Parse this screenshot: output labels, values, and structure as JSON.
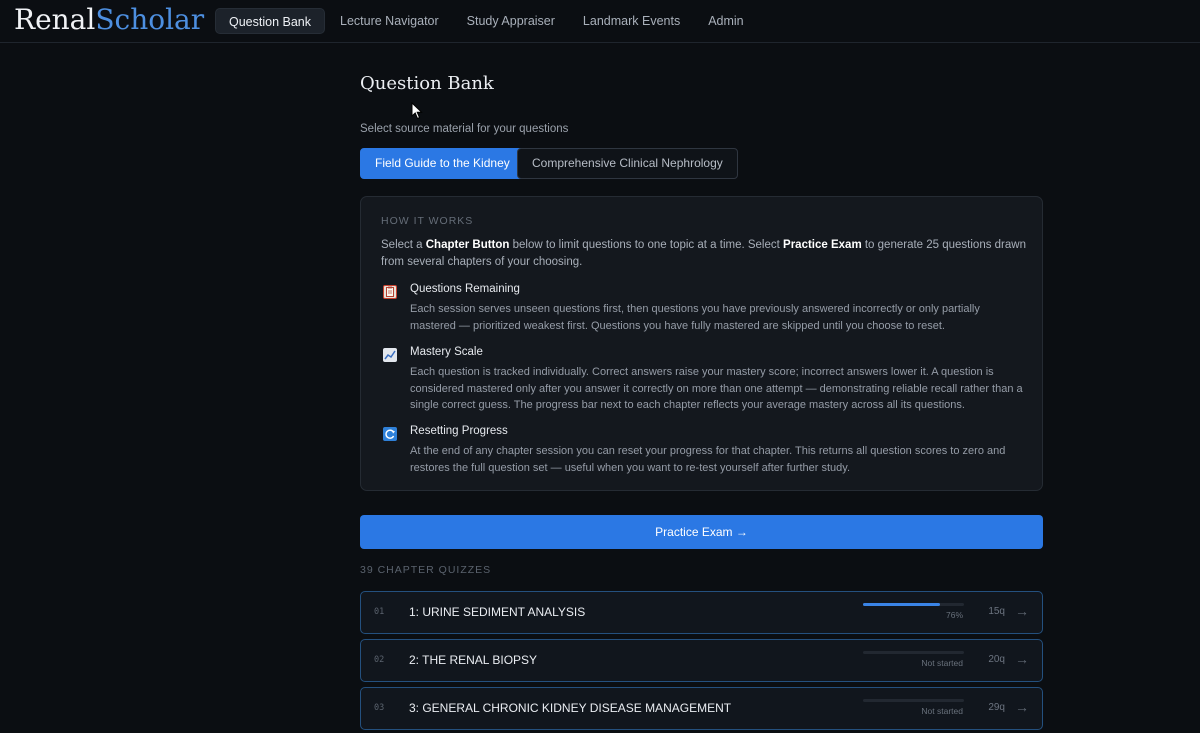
{
  "app": {
    "logo_part1": "Renal",
    "logo_part2": "Scholar"
  },
  "nav": {
    "items": [
      {
        "label": "Question Bank",
        "active": true
      },
      {
        "label": "Lecture Navigator"
      },
      {
        "label": "Study Appraiser"
      },
      {
        "label": "Landmark Events"
      },
      {
        "label": "Admin"
      }
    ]
  },
  "page": {
    "title": "Question Bank",
    "source_label": "Select source material for your questions",
    "sources": [
      {
        "label": "Field Guide to the Kidney",
        "selected": true
      },
      {
        "label": "Comprehensive Clinical Nephrology",
        "selected": false
      }
    ]
  },
  "how_it_works": {
    "heading": "HOW IT WORKS",
    "intro_1": "Select a ",
    "intro_bold_1": "Chapter Button",
    "intro_2": " below to limit questions to one topic at a time. Select ",
    "intro_bold_2": "Practice Exam",
    "intro_3": " to generate 25 questions drawn from several chapters of your choosing.",
    "features": [
      {
        "icon": "clipboard-icon",
        "title": "Questions Remaining",
        "text": "Each session serves unseen questions first, then questions you have previously answered incorrectly or only partially mastered — prioritized weakest first. Questions you have fully mastered are skipped until you choose to reset."
      },
      {
        "icon": "chart-up-icon",
        "title": "Mastery Scale",
        "text": "Each question is tracked individually. Correct answers raise your mastery score; incorrect answers lower it. A question is considered mastered only after you answer it correctly on more than one attempt — demonstrating reliable recall rather than a single correct guess. The progress bar next to each chapter reflects your average mastery across all its questions."
      },
      {
        "icon": "reset-icon",
        "title": "Resetting Progress",
        "text": "At the end of any chapter session you can reset your progress for that chapter. This returns all question scores to zero and restores the full question set — useful when you want to re-test yourself after further study."
      }
    ]
  },
  "practice_exam": {
    "label": "Practice Exam →"
  },
  "chapters": {
    "heading": "39 CHAPTER QUIZZES",
    "items": [
      {
        "num": "01",
        "name": "1: URINE SEDIMENT ANALYSIS",
        "status": "76%",
        "progress": 0.76,
        "count": "15q",
        "arrow": "→"
      },
      {
        "num": "02",
        "name": "2: THE RENAL BIOPSY",
        "status": "Not started",
        "progress": 0,
        "count": "20q",
        "arrow": "→"
      },
      {
        "num": "03",
        "name": "3: GENERAL CHRONIC KIDNEY DISEASE MANAGEMENT",
        "status": "Not started",
        "progress": 0,
        "count": "29q",
        "arrow": "→"
      }
    ]
  },
  "colors": {
    "accent": "#2b78e4",
    "logo_accent": "#4d8fe0",
    "background": "#0b0e12"
  }
}
